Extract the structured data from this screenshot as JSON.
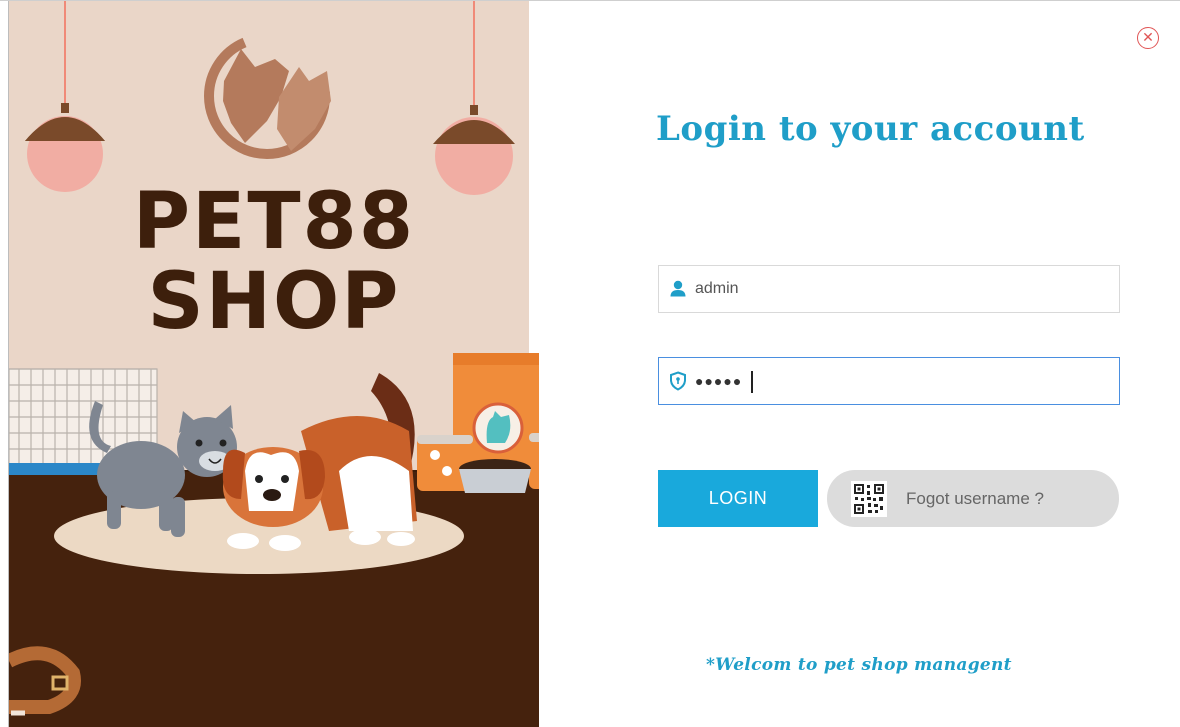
{
  "brand": {
    "line1": "PET88",
    "line2": "SHOP"
  },
  "login": {
    "title": "Login to your account",
    "username_value": "admin",
    "password_value": "●●●●●",
    "login_label": "LOGIN",
    "forgot_label": "Fogot username ?",
    "welcome_text": "*Welcom to pet shop managent"
  },
  "icons": {
    "close": "close-icon",
    "user": "user-icon",
    "password": "shield-icon",
    "qr": "qr-code-icon"
  },
  "colors": {
    "accent": "#1f9ec8",
    "login_button": "#19a9dc",
    "brand_dark": "#3d1f0c",
    "illustration_bg": "#ead6c8",
    "floor": "#45220d",
    "close": "#e05555"
  }
}
